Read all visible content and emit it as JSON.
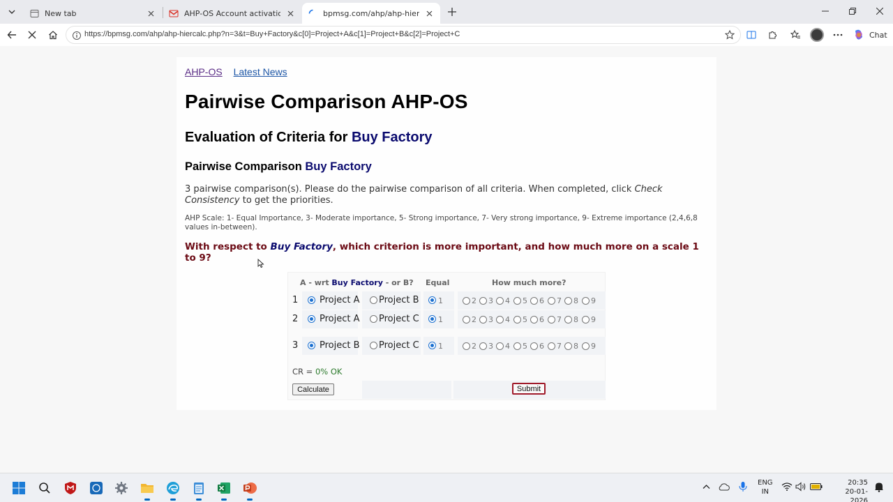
{
  "browser": {
    "tabs": [
      {
        "title": "New tab"
      },
      {
        "title": "AHP-OS Account activation - yasa"
      },
      {
        "title": "bpmsg.com/ahp/ahp-hiercalc.php"
      }
    ],
    "url": "https://bpmsg.com/ahp/ahp-hiercalc.php?n=3&t=Buy+Factory&c[0]=Project+A&c[1]=Project+B&c[2]=Project+C",
    "copilot_label": "Chat"
  },
  "page": {
    "nav": {
      "ahp_os": "AHP-OS",
      "latest_news": "Latest News"
    },
    "title": "Pairwise Comparison AHP-OS",
    "eval_prefix": "Evaluation of Criteria for ",
    "goal": "Buy Factory",
    "pc_prefix": "Pairwise Comparison ",
    "intro_a": "3 pairwise comparison(s). Please do the pairwise comparison of all criteria. When completed, click ",
    "intro_em": "Check Consistency",
    "intro_b": " to get the priorities.",
    "scale_text": "AHP Scale: 1- Equal Importance, 3- Moderate importance, 5- Strong importance, 7- Very strong importance, 9- Extreme importance (2,4,6,8 values in-between).",
    "question_a": "With respect to ",
    "question_b": ", which criterion is more important, and how much more on a scale 1 to 9?",
    "table": {
      "hdr_a": "A - wrt ",
      "hdr_b": " - or B?",
      "hdr_equal": "Equal",
      "hdr_more": "How much more?",
      "equal_value": "1",
      "scale_values": [
        "2",
        "3",
        "4",
        "5",
        "6",
        "7",
        "8",
        "9"
      ],
      "rows": [
        {
          "num": "1",
          "a": "Project A",
          "b": "Project B",
          "selected": "A",
          "intensity": 1
        },
        {
          "num": "2",
          "a": "Project A",
          "b": "Project C",
          "selected": "A",
          "intensity": 1
        },
        {
          "num": "3",
          "a": "Project B",
          "b": "Project C",
          "selected": "A",
          "intensity": 1
        }
      ],
      "cr_label": "CR = ",
      "cr_value": "0%",
      "cr_status": "OK",
      "calculate": "Calculate",
      "submit": "Submit"
    }
  },
  "taskbar": {
    "lang_1": "ENG",
    "lang_2": "IN",
    "time": "20:35",
    "date": "20-01-2026"
  }
}
